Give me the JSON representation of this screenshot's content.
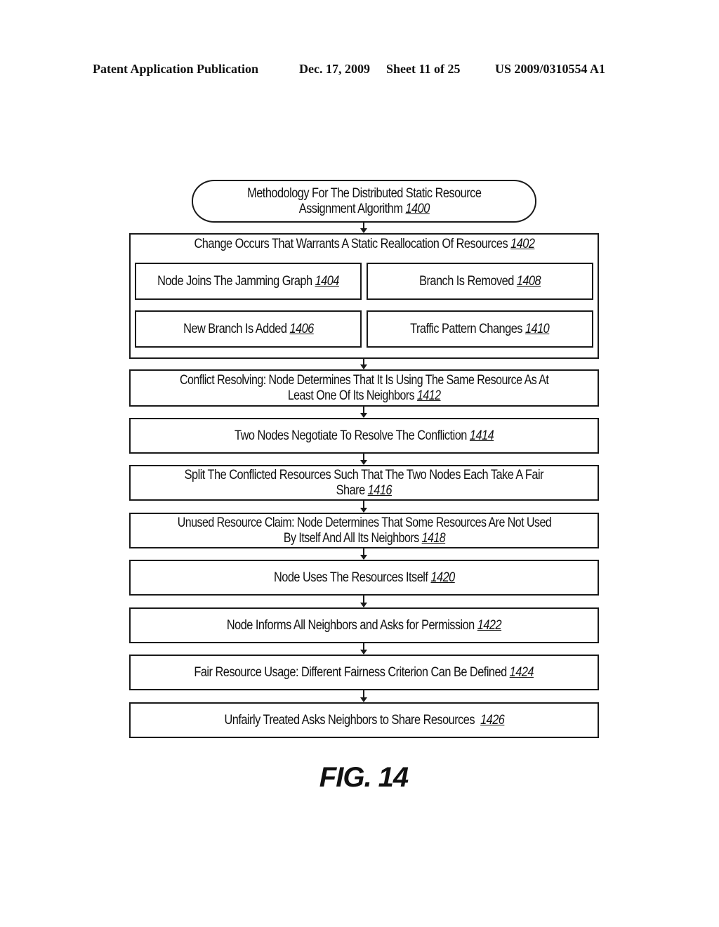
{
  "header": {
    "publication": "Patent Application Publication",
    "date": "Dec. 17, 2009",
    "sheet": "Sheet 11 of 25",
    "number": "US 2009/0310554 A1"
  },
  "flowchart": {
    "start": {
      "line1": "Methodology For The Distributed Static Resource",
      "line2": "Assignment Algorithm ",
      "ref": "1400"
    },
    "change": {
      "text": "Change Occurs That Warrants A Static Reallocation Of Resources ",
      "ref": "1402"
    },
    "triggers": [
      {
        "text": "Node Joins The Jamming Graph ",
        "ref": "1404"
      },
      {
        "text": "Branch Is Removed ",
        "ref": "1408"
      },
      {
        "text": "New Branch Is Added ",
        "ref": "1406"
      },
      {
        "text": "Traffic Pattern Changes ",
        "ref": "1410"
      }
    ],
    "steps": [
      {
        "line1": "Conflict Resolving: Node Determines That It Is Using The Same Resource As At",
        "line2": "Least One Of Its Neighbors ",
        "ref": "1412"
      },
      {
        "line1": "",
        "line2": "Two Nodes Negotiate To Resolve The Confliction ",
        "ref": "1414"
      },
      {
        "line1": "Split The Conflicted Resources Such That The Two Nodes Each Take A Fair",
        "line2": "Share ",
        "ref": "1416"
      },
      {
        "line1": "Unused Resource Claim: Node Determines That Some Resources Are Not Used",
        "line2": "By Itself And All Its Neighbors ",
        "ref": "1418"
      },
      {
        "line1": "",
        "line2": "Node Uses The Resources Itself ",
        "ref": "1420"
      },
      {
        "line1": "",
        "line2": "Node Informs All Neighbors and Asks for Permission ",
        "ref": "1422"
      },
      {
        "line1": "",
        "line2": "Fair Resource Usage: Different Fairness Criterion Can Be Defined ",
        "ref": "1424"
      },
      {
        "line1": "",
        "line2": "Unfairly Treated Asks Neighbors to Share Resources  ",
        "ref": "1426"
      }
    ]
  },
  "figure_label": "FIG. 14"
}
